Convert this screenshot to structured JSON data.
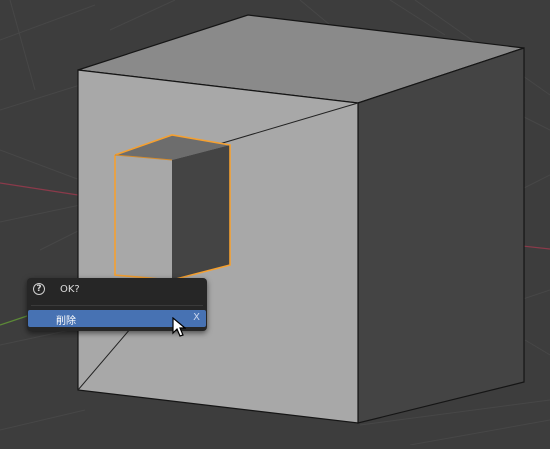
{
  "popup": {
    "icon": "question-icon",
    "icon_glyph": "?",
    "title": "OK?",
    "items": [
      {
        "label": "削除",
        "shortcut": "X",
        "highlighted": true
      }
    ]
  },
  "viewport": {
    "background_color": "#3d3d3d",
    "selection_color": "#f5a030",
    "popup_highlight_color": "#4772b3"
  }
}
